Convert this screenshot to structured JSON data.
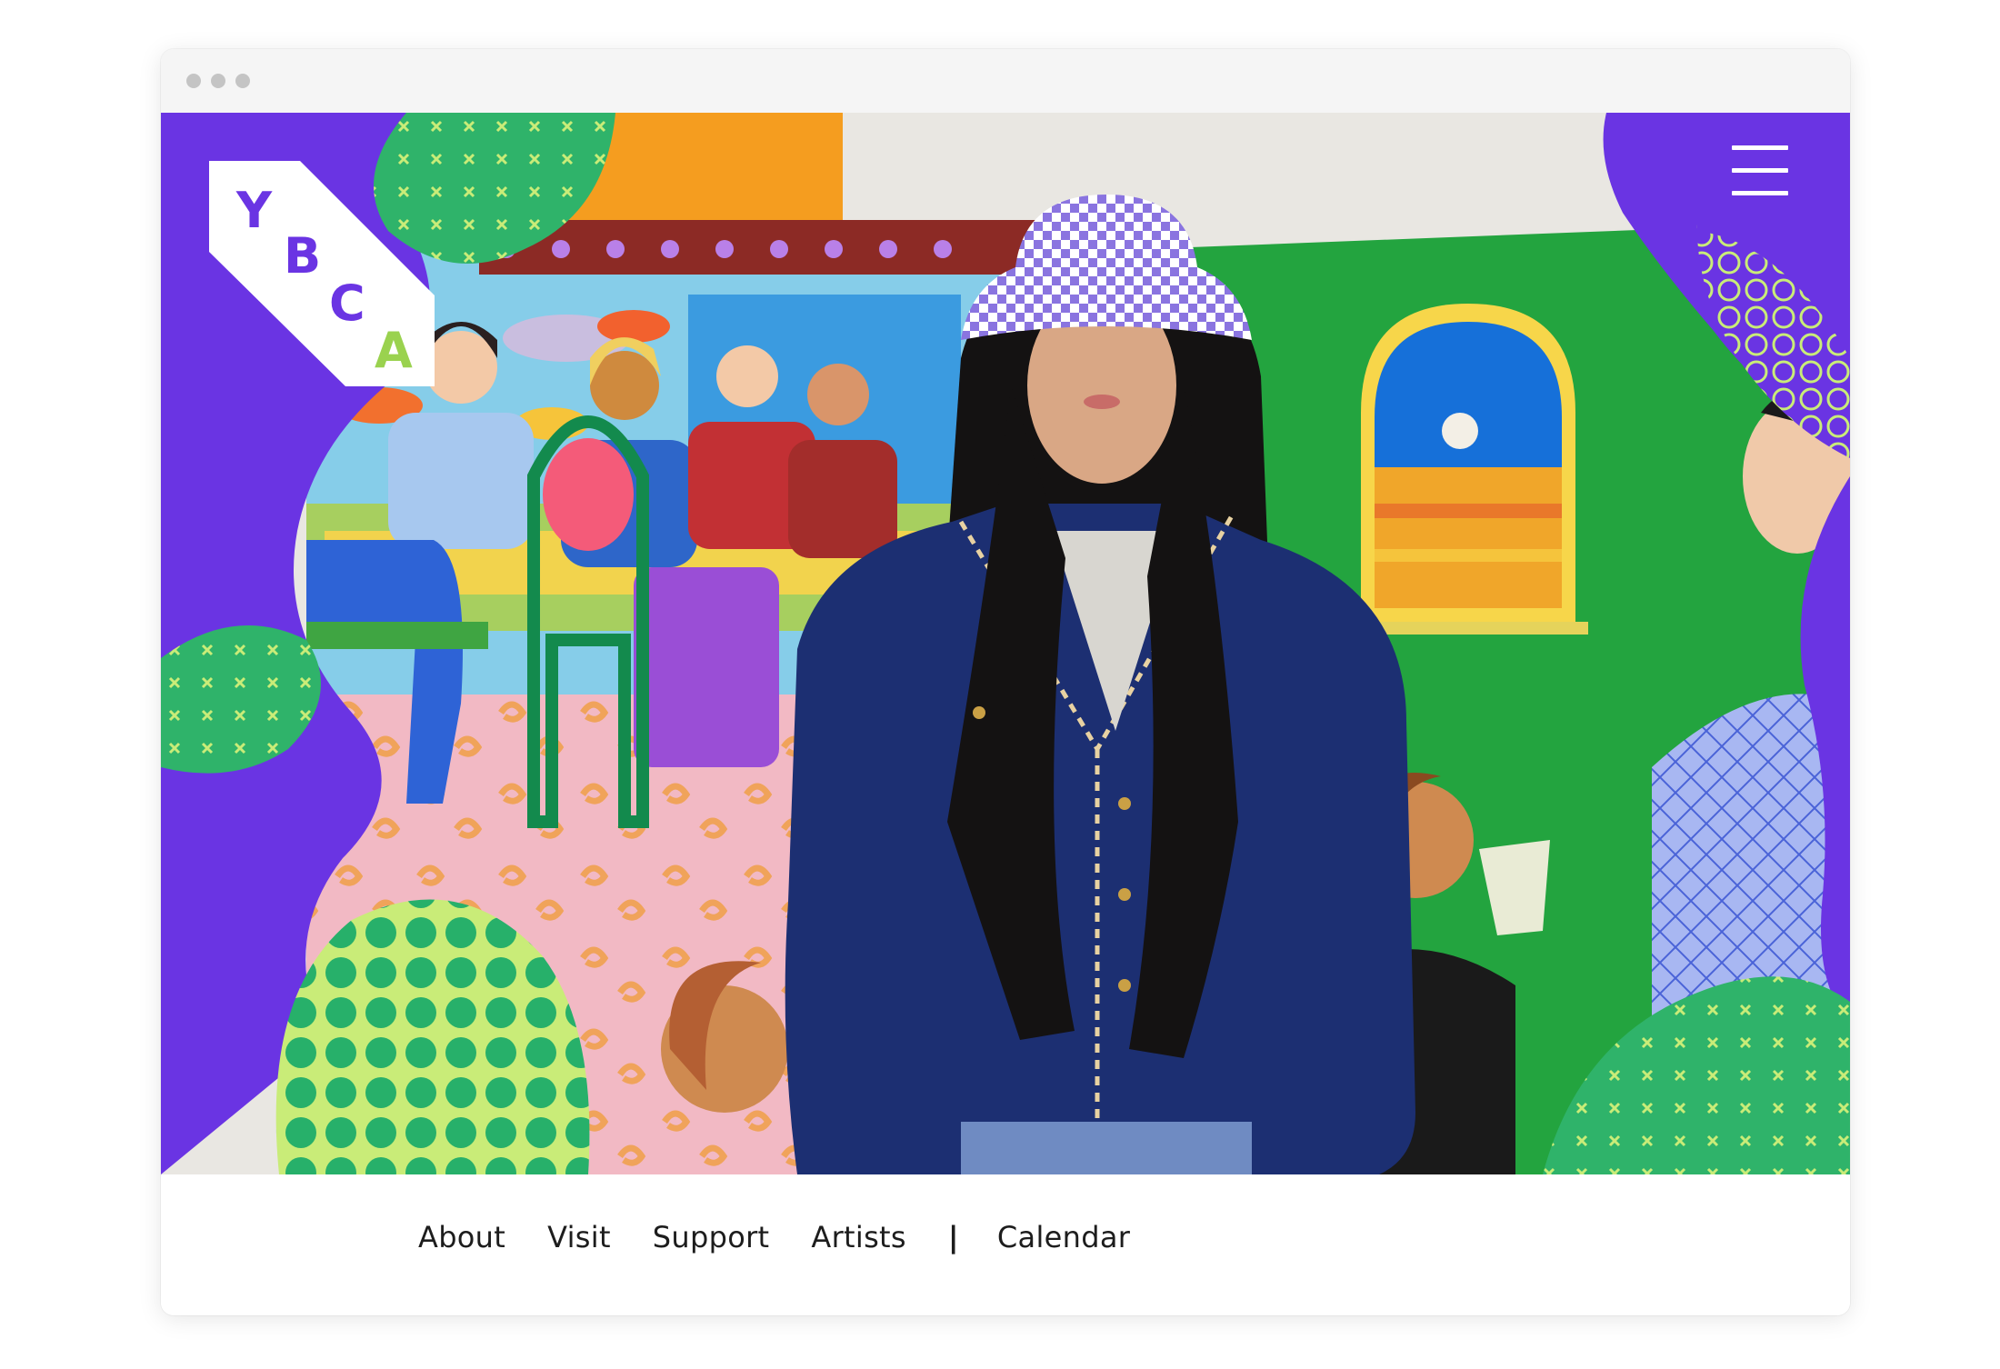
{
  "brand": {
    "letters": [
      "Y",
      "B",
      "C",
      "A"
    ],
    "letter_color": "#6a34e3",
    "accent_color": "#a8e05f"
  },
  "header": {
    "menu_icon": "hamburger-menu-icon"
  },
  "hero": {
    "image_subject": "artist-portrait-with-mural"
  },
  "nav": {
    "items": [
      {
        "label": "About"
      },
      {
        "label": "Visit"
      },
      {
        "label": "Support"
      },
      {
        "label": "Artists"
      }
    ],
    "separator": "|",
    "calendar_label": "Calendar"
  },
  "colors": {
    "purple": "#6a34e3",
    "green": "#1fa84b",
    "orange": "#f4a21d",
    "blue": "#2f7be0"
  }
}
